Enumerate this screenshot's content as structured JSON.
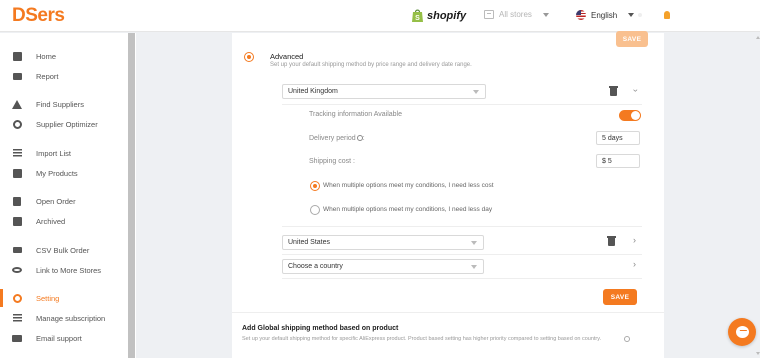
{
  "header": {
    "logo": "DSers",
    "platform": "shopify",
    "store_selector": "All stores",
    "language": "English"
  },
  "sidebar": {
    "items": [
      {
        "label": "Home",
        "icon": "home-grid-icon"
      },
      {
        "label": "Report",
        "icon": "report-icon"
      },
      {
        "label": "Find Suppliers",
        "icon": "house-icon"
      },
      {
        "label": "Supplier Optimizer",
        "icon": "search-icon"
      },
      {
        "label": "Import List",
        "icon": "list-icon"
      },
      {
        "label": "My Products",
        "icon": "products-icon"
      },
      {
        "label": "Open Order",
        "icon": "order-icon"
      },
      {
        "label": "Archived",
        "icon": "archive-icon"
      },
      {
        "label": "CSV Bulk Order",
        "icon": "megaphone-icon"
      },
      {
        "label": "Link to More Stores",
        "icon": "link-icon"
      },
      {
        "label": "Setting",
        "icon": "gear-icon",
        "active": true
      },
      {
        "label": "Manage subscription",
        "icon": "sliders-icon"
      },
      {
        "label": "Email support",
        "icon": "envelope-icon"
      }
    ]
  },
  "content": {
    "save_top": "SAVE",
    "advanced": {
      "title": "Advanced",
      "description": "Set up your default shipping method by price range and delivery date range."
    },
    "country_rows": [
      {
        "country": "United Kingdom"
      },
      {
        "country": "United States"
      },
      {
        "country": "Choose a country"
      }
    ],
    "settings": {
      "tracking_label": "Tracking information Available",
      "delivery_label": "Delivery period",
      "delivery_value": "5 days",
      "cost_label": "Shipping cost :",
      "cost_value": "$ 5",
      "option_less_cost": "When multiple options meet my conditions, I need less cost",
      "option_less_day": "When multiple options meet my conditions, I need less day"
    },
    "save_bottom": "SAVE",
    "global": {
      "title": "Add Global shipping method based on product",
      "description": "Set up your default shipping method for specific AliExpress product. Product based setting has higher priority compared to setting based on country."
    }
  },
  "colors": {
    "accent": "#f47a20",
    "accent_disabled": "#f9c08f"
  }
}
